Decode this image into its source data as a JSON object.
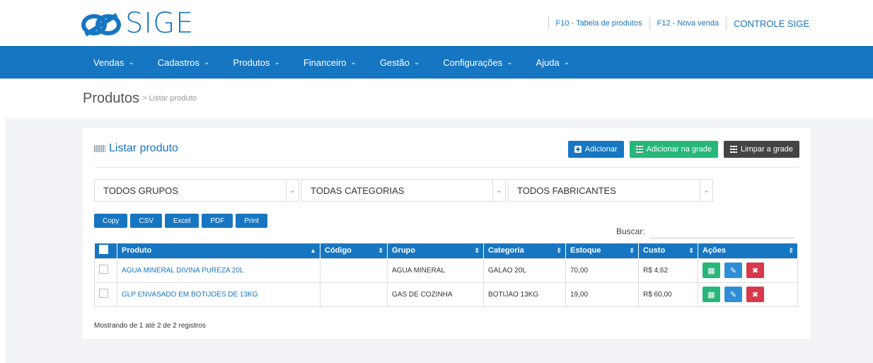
{
  "header": {
    "logo_text": "SIGE",
    "links": [
      "F10 - Tabela de produtos",
      "F12 - Nova venda"
    ],
    "brand": "CONTROLE SIGE"
  },
  "nav": {
    "items": [
      "Vendas",
      "Cadastros",
      "Produtos",
      "Financeiro",
      "Gestão",
      "Configurações",
      "Ajuda"
    ]
  },
  "breadcrumb": {
    "main": "Produtos",
    "sub": "> Listar produto"
  },
  "panel": {
    "title": "Listar produto",
    "buttons": {
      "add": "Adicionar",
      "add_grid": "Adicionar na grade",
      "clear_grid": "Limpar a grade"
    }
  },
  "filters": {
    "grupos": "TODOS GRUPOS",
    "categorias": "TODAS CATEGORIAS",
    "fabricantes": "TODOS FABRICANTES"
  },
  "exports": [
    "Copy",
    "CSV",
    "Excel",
    "PDF",
    "Print"
  ],
  "search": {
    "label": "Buscar:",
    "value": ""
  },
  "table": {
    "columns": [
      "Produto",
      "Código",
      "Grupo",
      "Categoria",
      "Estoque",
      "Custo",
      "Ações"
    ],
    "rows": [
      {
        "produto": "AGUA MINERAL DIVINA PUREZA 20L",
        "codigo": "",
        "grupo": "AGUA MINERAL",
        "categoria": "GALAO 20L",
        "estoque": "70,00",
        "custo": "R$ 4,62"
      },
      {
        "produto": "GLP ENVASADO EM BOTIJOES DE 13KG",
        "codigo": "",
        "grupo": "GAS DE COZINHA",
        "categoria": "BOTIJAO 13KG",
        "estoque": "19,00",
        "custo": "R$ 60,00"
      }
    ]
  },
  "footer": {
    "info": "Mostrando de 1 até 2 de 2 registros"
  },
  "colors": {
    "primary": "#1776c2",
    "success": "#26b779",
    "danger": "#d9384a",
    "dark": "#444444"
  },
  "icons": {
    "add": "plus-square-icon",
    "grid": "grid-icon",
    "edit": "pencil-icon",
    "delete": "close-icon"
  }
}
